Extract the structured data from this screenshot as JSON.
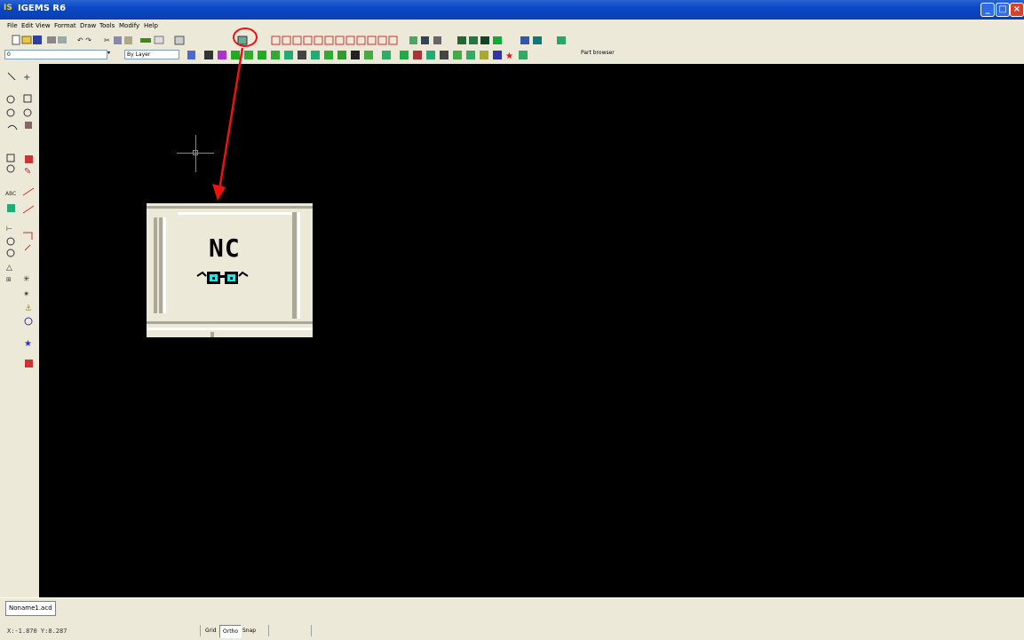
{
  "window": {
    "title": "IGEMS R6",
    "app_icon_text": "IS"
  },
  "menu": [
    "File",
    "Edit",
    "View",
    "Format",
    "Draw",
    "Tools",
    "Modify",
    "Help"
  ],
  "toolbar2": {
    "layer_value": "0",
    "linetype_value": "By Layer",
    "part_browser_label": "Part browser"
  },
  "zoom_callout": {
    "icon_text": "NC"
  },
  "document_tab": "Noname1.acd",
  "status": {
    "coordinates": "X:-1.870 Y:8.287",
    "buttons": [
      "Grid",
      "Ortho",
      "Snap"
    ],
    "pressed": "Ortho"
  },
  "colors": {
    "accent_red": "#e11111",
    "canvas": "#000000",
    "chrome": "#ece9d8",
    "title_blue": "#0a47c6",
    "nc_cyan": "#27e3e8"
  }
}
